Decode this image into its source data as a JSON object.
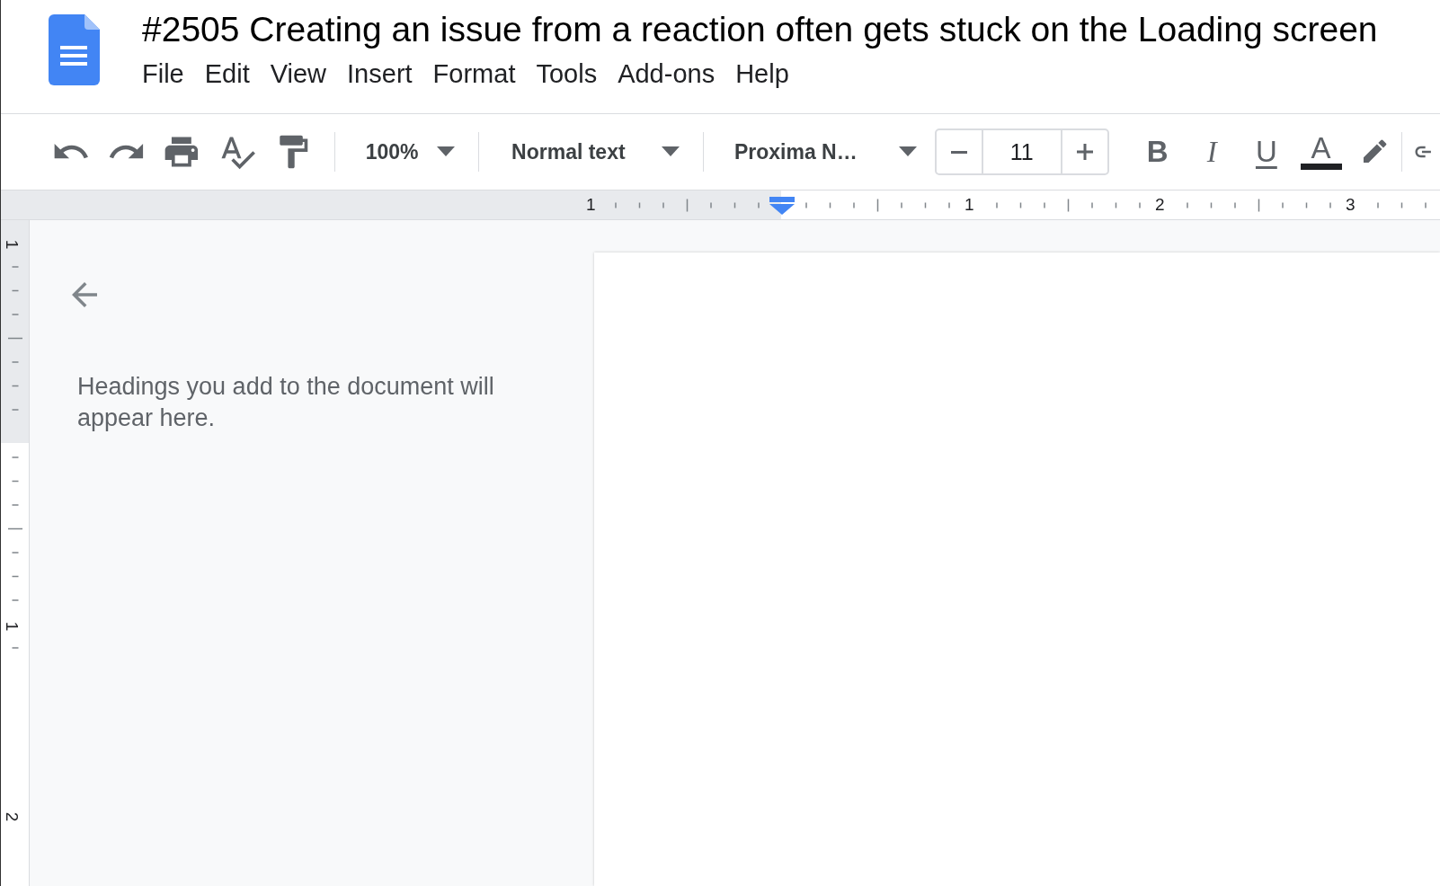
{
  "document": {
    "title": "#2505 Creating an issue from a reaction often gets stuck on the Loading screen"
  },
  "menu": [
    "File",
    "Edit",
    "View",
    "Insert",
    "Format",
    "Tools",
    "Add-ons",
    "Help"
  ],
  "toolbar": {
    "zoom": "100%",
    "style": "Normal text",
    "font": "Proxima N…",
    "font_size": "11",
    "format_buttons": [
      {
        "kind": "bold",
        "label": "B"
      },
      {
        "kind": "italic",
        "label": "I"
      },
      {
        "kind": "underline",
        "label": "U"
      },
      {
        "kind": "color",
        "label": "A",
        "color": "#202124"
      }
    ]
  },
  "ruler": {
    "horizontal_labels": [
      "1",
      "1",
      "2",
      "3"
    ],
    "vertical_labels": [
      "1",
      "1",
      "2"
    ]
  },
  "outline": {
    "hint": "Headings you add to the document will appear here."
  }
}
